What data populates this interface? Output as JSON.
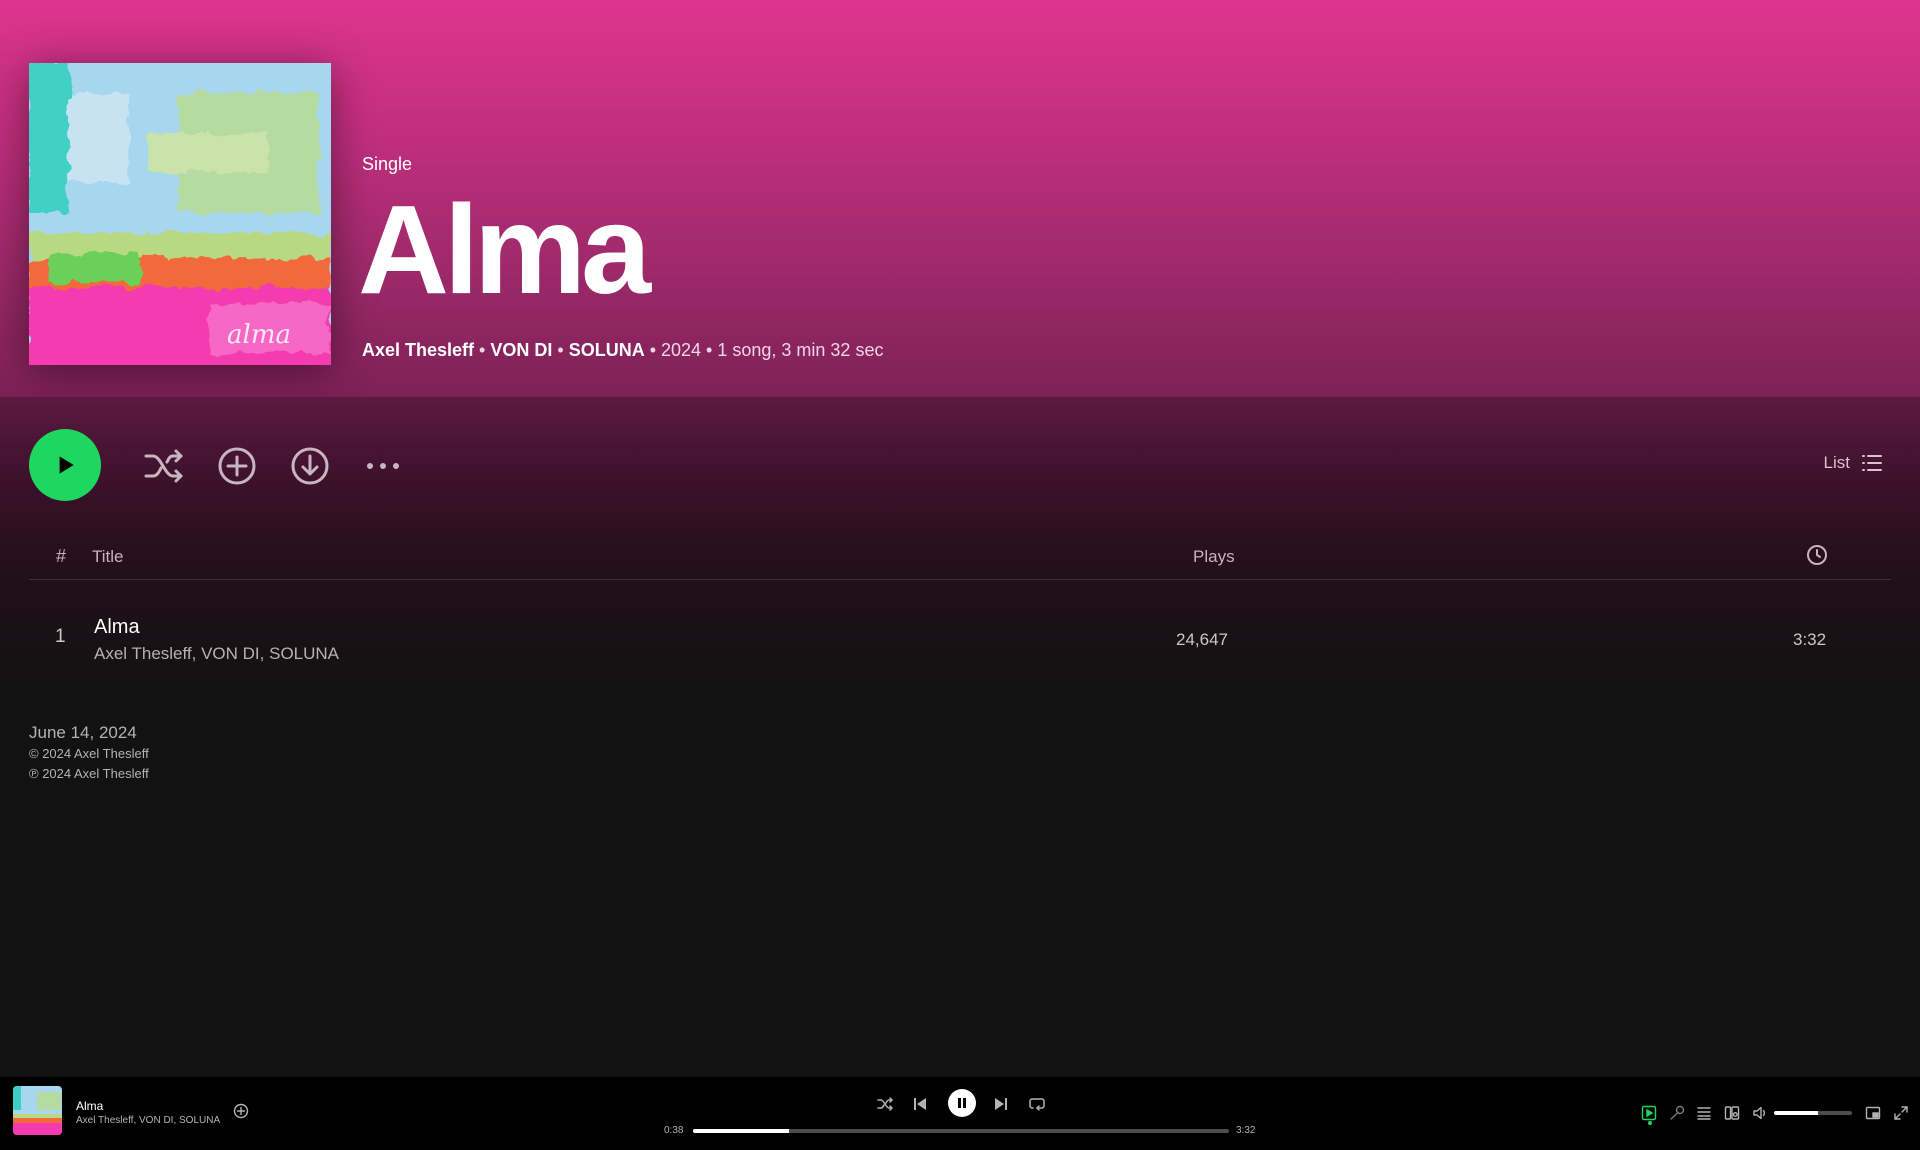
{
  "album": {
    "type_label": "Single",
    "title": "Alma",
    "artists": [
      "Axel Thesleff",
      "VON DI",
      "SOLUNA"
    ],
    "year": "2024",
    "summary": "1 song, 3 min 32 sec",
    "cover_signature": "alma"
  },
  "actions": {
    "view_mode_label": "List"
  },
  "table": {
    "headers": {
      "number": "#",
      "title": "Title",
      "plays": "Plays"
    },
    "tracks": [
      {
        "number": "1",
        "title": "Alma",
        "artists": "Axel Thesleff, VON DI, SOLUNA",
        "plays": "24,647",
        "duration": "3:32"
      }
    ]
  },
  "release": {
    "date": "June 14, 2024",
    "copyright": "© 2024 Axel Thesleff",
    "phonographic": "℗ 2024 Axel Thesleff"
  },
  "player": {
    "now_playing_title": "Alma",
    "now_playing_artists": "Axel Thesleff, VON DI, SOLUNA",
    "elapsed": "0:38",
    "total": "3:32",
    "progress_fraction": 0.18,
    "volume_fraction": 0.56,
    "is_playing": true
  },
  "icons": {
    "play": "play-icon",
    "shuffle": "shuffle-icon",
    "add": "add-circle-icon",
    "download": "download-icon",
    "more": "more-icon",
    "list": "list-icon",
    "clock": "clock-icon"
  },
  "colors": {
    "accent_green": "#1ed760",
    "hero_pink": "#dd358d",
    "background": "#121212"
  }
}
